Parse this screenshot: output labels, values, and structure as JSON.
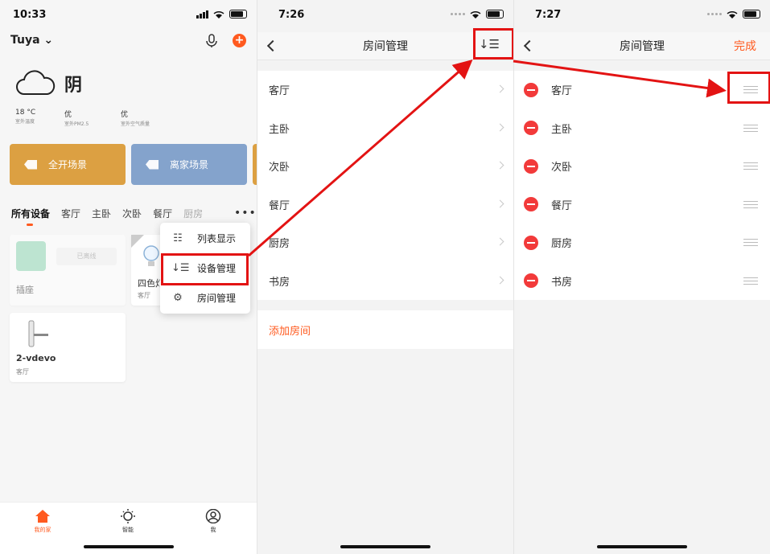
{
  "colors": {
    "accent": "#ff5a1f",
    "highlight": "#e31313",
    "scene1": "#dca042",
    "scene2": "#84a3cc",
    "delete": "#f23a3a"
  },
  "panel1": {
    "time": "10:33",
    "home": "Tuya",
    "weather": {
      "condition": "阴",
      "temp": "18 °C",
      "temp_label": "室外温度",
      "pm": "优",
      "pm_label": "室外PM2.5",
      "air": "优",
      "air_label": "室外空气质量"
    },
    "scenes": [
      "全开场景",
      "离家场景"
    ],
    "tabs": [
      "所有设备",
      "客厅",
      "主卧",
      "次卧",
      "餐厅",
      "厨房"
    ],
    "devices": [
      {
        "name": "插座",
        "status": "已离线"
      },
      {
        "name": "四色灯",
        "room": "客厅"
      },
      {
        "name": "2-vdevo",
        "room": "客厅"
      }
    ],
    "menu": [
      "列表显示",
      "设备管理",
      "房间管理"
    ],
    "nav": [
      "我的家",
      "智能",
      "我"
    ]
  },
  "panel2": {
    "time": "7:26",
    "title": "房间管理",
    "sort_icon": "↓☰",
    "rooms": [
      "客厅",
      "主卧",
      "次卧",
      "餐厅",
      "厨房",
      "书房"
    ],
    "add_room": "添加房间"
  },
  "panel3": {
    "time": "7:27",
    "title": "房间管理",
    "done": "完成",
    "rooms": [
      "客厅",
      "主卧",
      "次卧",
      "餐厅",
      "厨房",
      "书房"
    ]
  }
}
